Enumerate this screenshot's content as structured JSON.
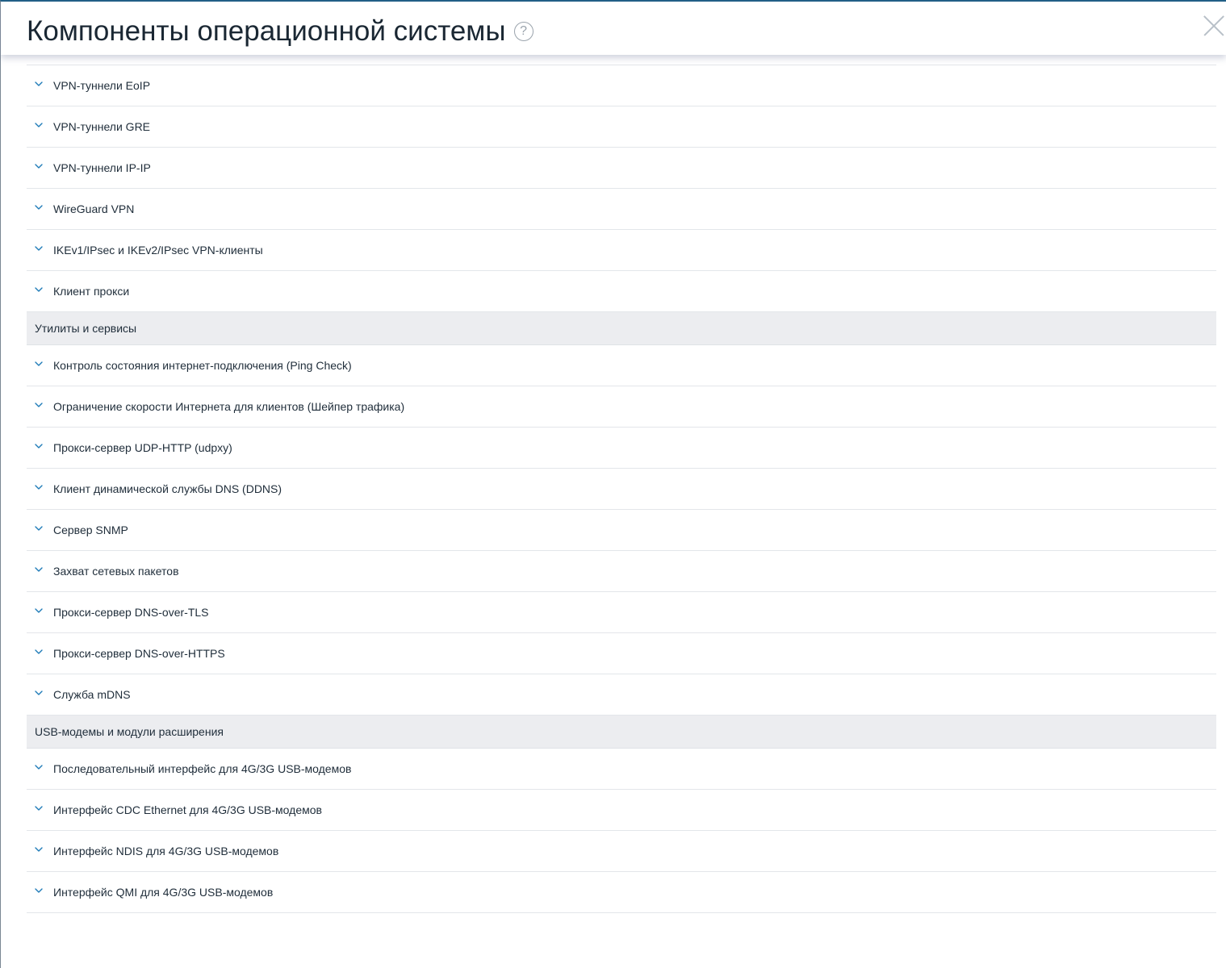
{
  "dialog": {
    "title": "Компоненты операционной системы",
    "help_glyph": "?"
  },
  "groups": [
    {
      "section": null,
      "items": [
        "VPN-туннели EoIP",
        "VPN-туннели GRE",
        "VPN-туннели IP-IP",
        "WireGuard VPN",
        "IKEv1/IPsec и IKEv2/IPsec VPN-клиенты",
        "Клиент прокси"
      ]
    },
    {
      "section": "Утилиты и сервисы",
      "items": [
        "Контроль состояния интернет-подключения (Ping Check)",
        "Ограничение скорости Интернета для клиентов (Шейпер трафика)",
        "Прокси-сервер UDP-HTTP (udpxy)",
        "Клиент динамической службы DNS (DDNS)",
        "Сервер SNMP",
        "Захват сетевых пакетов",
        "Прокси-сервер DNS-over-TLS",
        "Прокси-сервер DNS-over-HTTPS",
        "Служба mDNS"
      ]
    },
    {
      "section": "USB-модемы и модули расширения",
      "items": [
        "Последовательный интерфейс для 4G/3G USB-модемов",
        "Интерфейс CDC Ethernet для 4G/3G USB-модемов",
        "Интерфейс NDIS для 4G/3G USB-модемов",
        "Интерфейс QMI для 4G/3G USB-модемов"
      ]
    }
  ],
  "colors": {
    "accent": "#1f7bb8",
    "section_bg": "#ecedf0",
    "divider": "#e3e6ea"
  },
  "icons": {
    "expand": "chevron-down-icon",
    "help": "help-icon",
    "close": "close-icon"
  }
}
